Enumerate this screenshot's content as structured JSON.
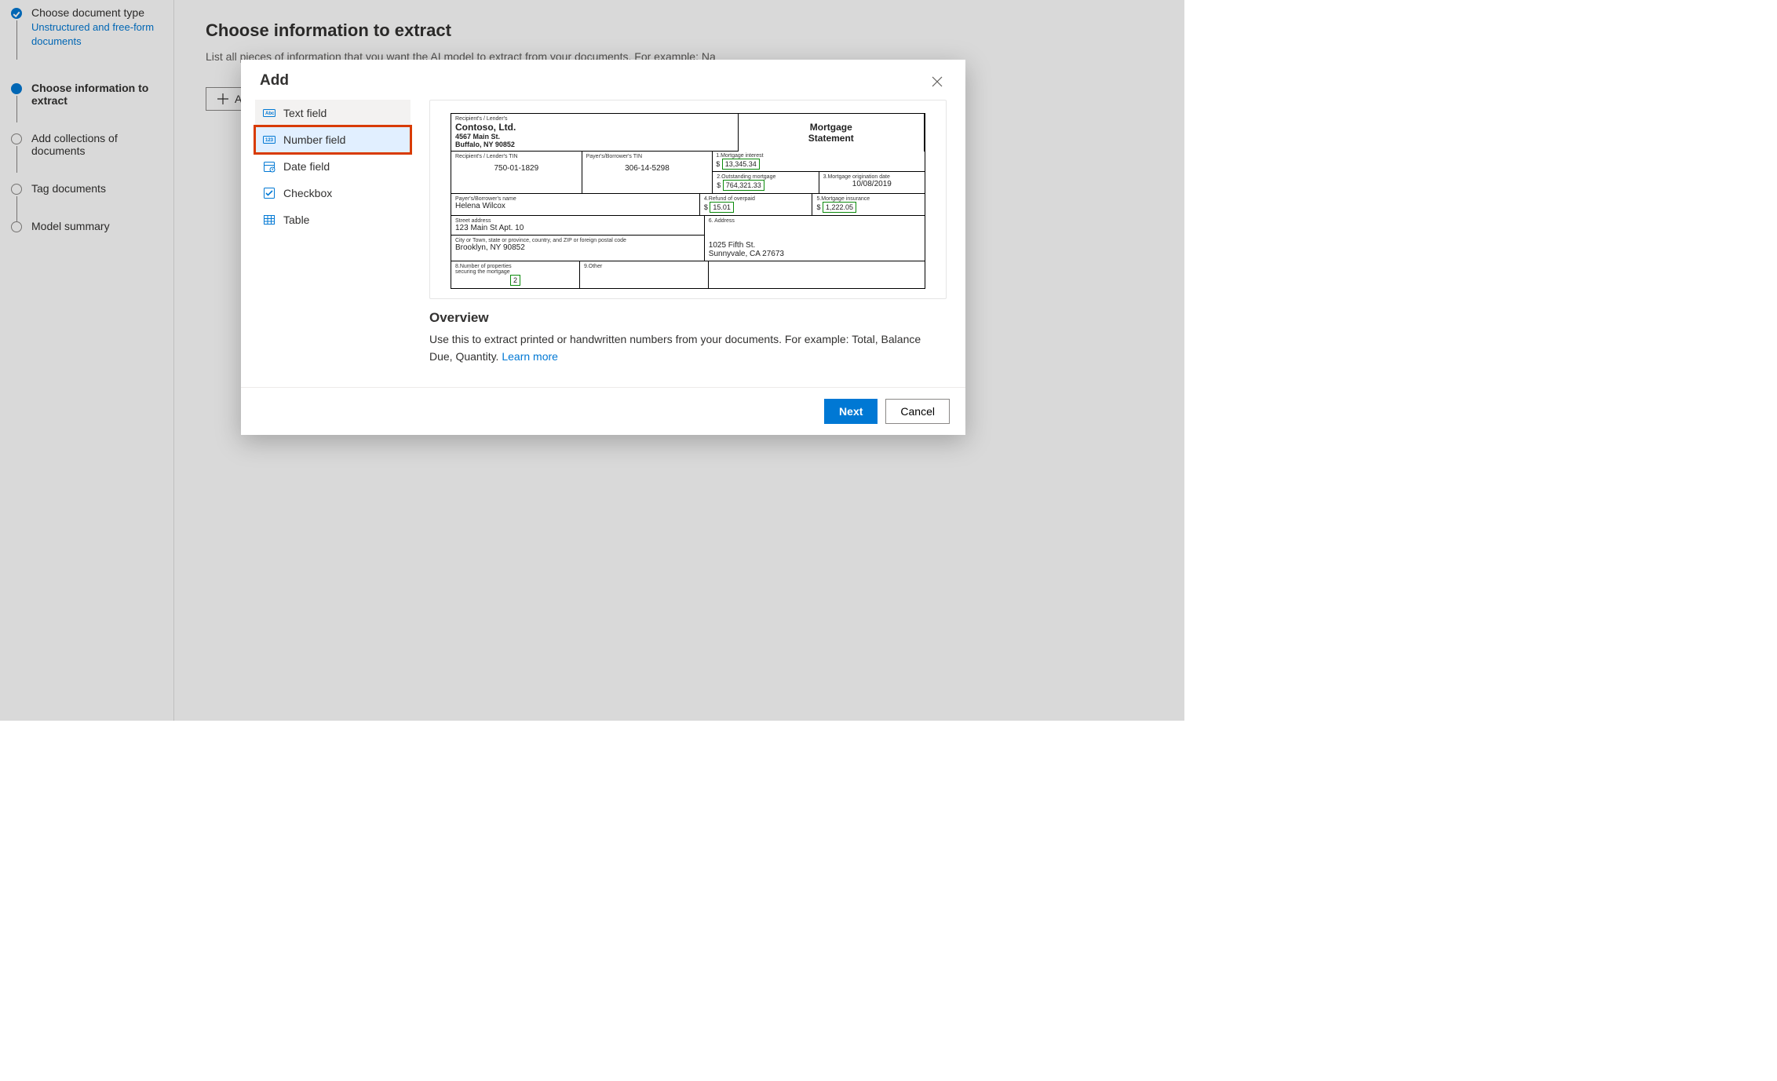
{
  "sidebar": {
    "steps": [
      {
        "title": "Choose document type",
        "sub": "Unstructured and free-form documents"
      },
      {
        "title": "Choose information to extract"
      },
      {
        "title": "Add collections of documents"
      },
      {
        "title": "Tag documents"
      },
      {
        "title": "Model summary"
      }
    ]
  },
  "main": {
    "heading": "Choose information to extract",
    "description": "List all pieces of information that you want the AI model to extract from your documents. For example: Na",
    "add_label": "Add"
  },
  "dialog": {
    "title": "Add",
    "types": [
      {
        "label": "Text field"
      },
      {
        "label": "Number field"
      },
      {
        "label": "Date field"
      },
      {
        "label": "Checkbox"
      },
      {
        "label": "Table"
      }
    ],
    "overview_title": "Overview",
    "overview_text": "Use this to extract printed or handwritten numbers from your documents. For example: Total, Balance Due, Quantity. ",
    "learn_more": "Learn more",
    "next": "Next",
    "cancel": "Cancel"
  },
  "doc": {
    "lender_small": "Recipient's / Lender's",
    "company": "Contoso, Ltd.",
    "addr1": "4567 Main St.",
    "addr2": "Buffalo, NY 90852",
    "title1": "Mortgage",
    "title2": "Statement",
    "c1_label": "Recipient's / Lender's TIN",
    "c1_value": "750-01-1829",
    "c2_label": "Payer's/Borrower's TIN",
    "c2_value": "306-14-5298",
    "c3_label": "1.Mortgage interest",
    "c3_value": "13,345.34",
    "c4_label": "2.Outstanding mortgage",
    "c4_value": "764,321.33",
    "c5_label": "3.Mortgage origination date",
    "c5_value": "10/08/2019",
    "c6_label": "Payer's/Borrower's name",
    "c6_value": "Helena Wilcox",
    "c7_label": "4.Refund of overpaid",
    "c7_value": "15.01",
    "c8_label": "5.Mortgage insurance",
    "c8_value": "1,222.05",
    "c9_label": "Street address",
    "c9_value": "123 Main St Apt. 10",
    "c10_label": "6. Address",
    "c11_label": "City or Town, state or province, country, and ZIP or foreign postal code",
    "c11_value": "Brooklyn, NY 90852",
    "c12_addr1": "1025 Fifth St.",
    "c12_addr2": "Sunnyvale, CA 27673",
    "c13_label": "8.Number of properties securing the mortgage",
    "c13_value": "2",
    "c14_label": "9.Other"
  }
}
